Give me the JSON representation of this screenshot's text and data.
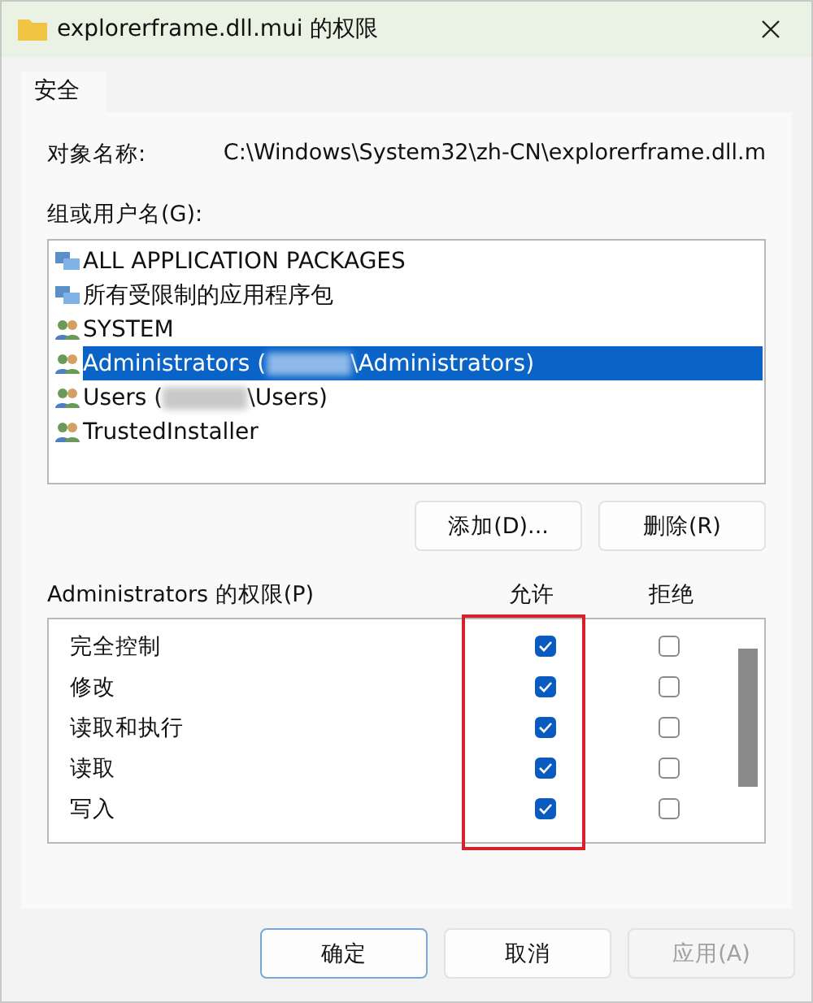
{
  "window": {
    "title": "explorerframe.dll.mui 的权限"
  },
  "tabs": [
    {
      "label": "安全",
      "selected": true
    }
  ],
  "object_name": {
    "label": "对象名称:",
    "value": "C:\\Windows\\System32\\zh-CN\\explorerframe.dll.m"
  },
  "groups": {
    "label": "组或用户名(G):",
    "items": [
      {
        "kind": "package",
        "name": "ALL APPLICATION PACKAGES",
        "selected": false
      },
      {
        "kind": "package",
        "name": "所有受限制的应用程序包",
        "selected": false
      },
      {
        "kind": "user",
        "name": "SYSTEM",
        "selected": false
      },
      {
        "kind": "redacted",
        "name": "Administrators (",
        "suffix": "\\Administrators)",
        "selected": true
      },
      {
        "kind": "redacted",
        "name": "Users (",
        "suffix": "\\Users)",
        "selected": false
      },
      {
        "kind": "user",
        "name": "TrustedInstaller",
        "selected": false
      }
    ],
    "buttons": [
      "添加(D)...",
      "删除(R)"
    ]
  },
  "permissions": {
    "label": "Administrators 的权限(P)",
    "allow_header": "允许",
    "deny_header": "拒绝",
    "rows": [
      {
        "name": "完全控制",
        "allow": true,
        "deny": false
      },
      {
        "name": "修改",
        "allow": true,
        "deny": false
      },
      {
        "name": "读取和执行",
        "allow": true,
        "deny": false
      },
      {
        "name": "读取",
        "allow": true,
        "deny": false
      },
      {
        "name": "写入",
        "allow": true,
        "deny": false
      }
    ]
  },
  "footer": [
    {
      "label": "确定",
      "kind": "default",
      "disabled": false
    },
    {
      "label": "取消",
      "kind": "normal",
      "disabled": false
    },
    {
      "label": "应用(A)",
      "kind": "normal",
      "disabled": true
    }
  ]
}
